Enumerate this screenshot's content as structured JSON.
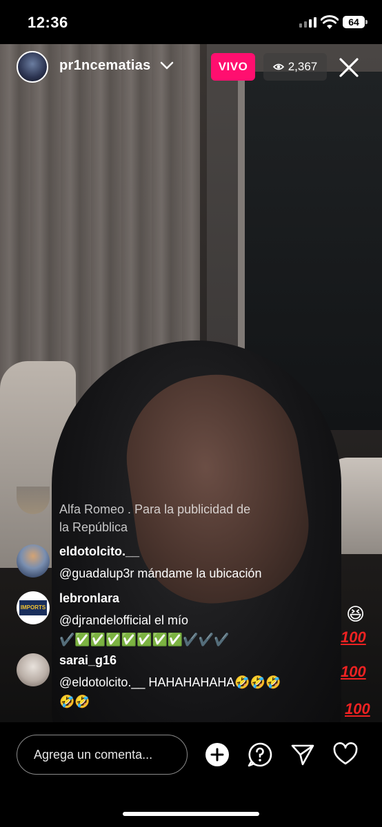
{
  "status_bar": {
    "time": "12:36",
    "battery": "64"
  },
  "live": {
    "username": "pr1ncematias",
    "live_label": "VIVO",
    "viewer_count": "2,367"
  },
  "caption": {
    "text_line1": "Alfa Romeo . Para la publicidad de",
    "text_line2": "la  República"
  },
  "comments": [
    {
      "user": "eldotolcito.__",
      "text": "@guadalup3r  mándame la ubicación"
    },
    {
      "user": "lebronlara",
      "text": "@djrandelofficial el mío",
      "text2": "✔️✅✅✅✅✅✅✅✔️✔️✔️"
    },
    {
      "user": "sarai_g16",
      "text": "@eldotolcito.__ HAHAHAHAHA🤣🤣🤣",
      "text2": "🤣🤣"
    }
  ],
  "lebron_avatar_text": "IMPORTS",
  "reactions": {
    "laugh": "😆",
    "hundred": "100"
  },
  "bottom_bar": {
    "comment_placeholder": "Agrega un comenta..."
  },
  "colors": {
    "live_badge": "#ff0f6f",
    "hundred": "#e22222"
  },
  "icons": [
    "wifi-icon",
    "signal-icon",
    "battery-icon",
    "chevron-down-icon",
    "eye-icon",
    "close-icon",
    "plus-icon",
    "question-icon",
    "send-icon",
    "heart-icon"
  ]
}
